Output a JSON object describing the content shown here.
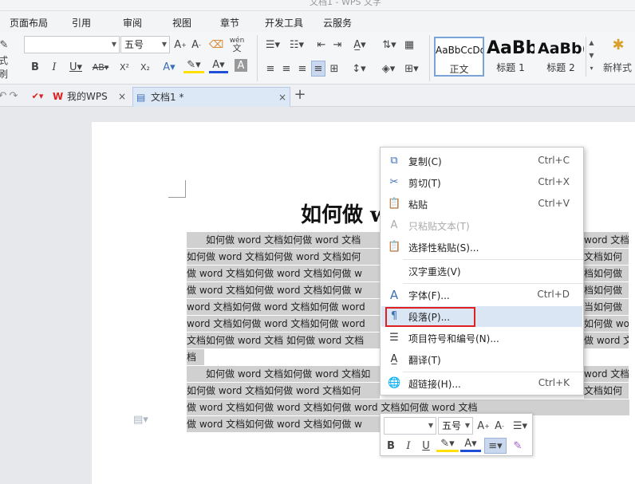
{
  "window": {
    "title_fragment": "文档1 - WPS 文字"
  },
  "menu": [
    "页面布局",
    "引用",
    "审阅",
    "视图",
    "章节",
    "开发工具",
    "云服务"
  ],
  "ribbon": {
    "font_name": "",
    "font_size": "五号",
    "format_brush": "式刷",
    "pinyin_top": "wén",
    "pinyin_bottom": "文",
    "styles": [
      {
        "preview": "AaBbCcDd",
        "label": "正文"
      },
      {
        "preview": "AaBb",
        "label": "标题 1"
      },
      {
        "preview": "AaBb(",
        "label": "标题 2"
      }
    ],
    "new_style": "新样式"
  },
  "tabs": {
    "home": "我的WPS",
    "doc": "文档1 *",
    "close": "×",
    "add": "+"
  },
  "document": {
    "title": "如何做 w",
    "lines": [
      "　　如何做 word 文档如何做 word 文档",
      "如何做 word 文档如何做 word 文档如何",
      "做 word 文档如何做 word 文档如何做 w",
      "做 word 文档如何做 word 文档如何做 w",
      "word 文档如何做 word 文档如何做 word",
      "word 文档如何做 word 文档如何做 word",
      "文档如何做 word 文档 如何做 word 文档",
      "档",
      "　　如何做 word 文档如何做 word 文档如",
      "如何做 word 文档如何做 word 文档如何",
      "做 word 文档如何做 word 文档如何做 word 文档如何做 word 文档",
      "做 word 文档如何做 word 文档如何做 w"
    ],
    "right_lines": [
      "word 文档",
      "文档如何",
      "档如何做",
      "档如何做",
      "当如何做",
      "如何做 word",
      "做 word 文档",
      "",
      "word 文档",
      "文档如何",
      "如何做 word",
      ""
    ]
  },
  "context_menu": [
    {
      "icon": "copy-icon",
      "label": "复制(C)",
      "shortcut": "Ctrl+C",
      "disabled": false
    },
    {
      "icon": "cut-icon",
      "label": "剪切(T)",
      "shortcut": "Ctrl+X",
      "disabled": false
    },
    {
      "icon": "paste-icon",
      "label": "粘贴",
      "shortcut": "Ctrl+V",
      "disabled": false
    },
    {
      "icon": "paste-text-icon",
      "label": "只粘贴文本(T)",
      "shortcut": "",
      "disabled": true
    },
    {
      "icon": "paste-special-icon",
      "label": "选择性粘贴(S)...",
      "shortcut": "",
      "disabled": false
    },
    {
      "icon": "",
      "label": "汉字重选(V)",
      "shortcut": "",
      "disabled": false
    },
    {
      "icon": "font-icon",
      "label": "字体(F)...",
      "shortcut": "Ctrl+D",
      "disabled": false
    },
    {
      "icon": "paragraph-icon",
      "label": "段落(P)...",
      "shortcut": "",
      "disabled": false
    },
    {
      "icon": "list-icon",
      "label": "项目符号和编号(N)...",
      "shortcut": "",
      "disabled": false
    },
    {
      "icon": "translate-icon",
      "label": "翻译(T)",
      "shortcut": "",
      "disabled": false
    },
    {
      "icon": "hyperlink-icon",
      "label": "超链接(H)...",
      "shortcut": "Ctrl+K",
      "disabled": false
    }
  ],
  "mini_toolbar": {
    "font_name": "",
    "font_size": "五号"
  },
  "colors": {
    "highlight_box": "#e02020",
    "menu_hover": "#dbe6f5",
    "selection": "#d0d0d0",
    "accent_red": "#e02020",
    "accent_blue": "#1e4fd6",
    "highlight_yellow": "#ffe000"
  }
}
